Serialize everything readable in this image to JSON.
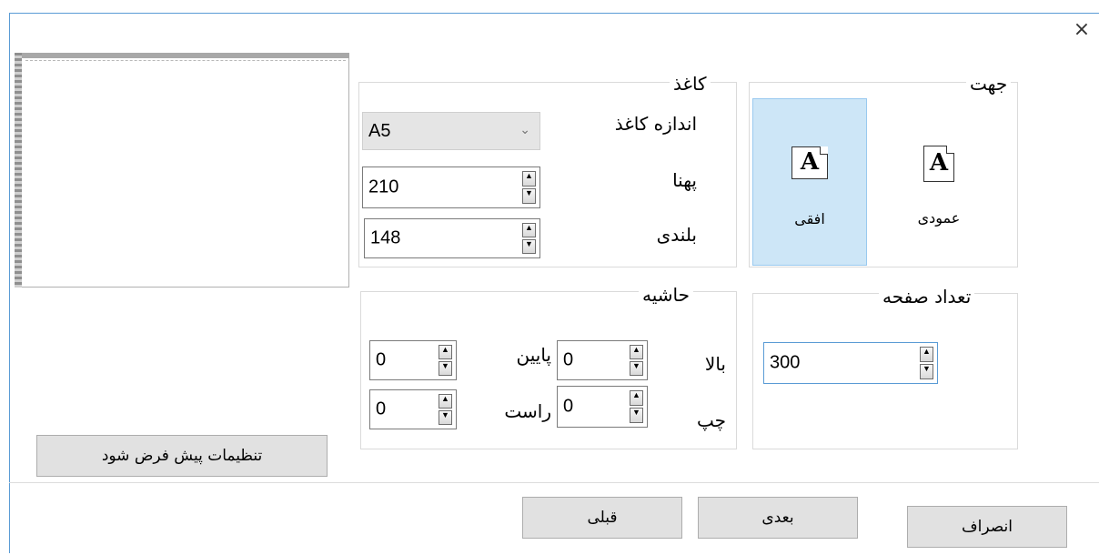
{
  "window": {
    "close_label": "×"
  },
  "orientation": {
    "legend": "جهت",
    "portrait_label": "عمودی",
    "landscape_label": "افقی",
    "icon_glyph": "A",
    "selected": "landscape"
  },
  "paper": {
    "legend": "کاغذ",
    "size_label": "اندازه کاغذ",
    "size_value": "A5",
    "width_label": "پهنا",
    "width_value": "210",
    "height_label": "بلندی",
    "height_value": "148"
  },
  "page_count": {
    "legend": "تعداد صفحه",
    "value": "300"
  },
  "margins": {
    "legend": "حاشیه",
    "top_label": "بالا",
    "top_value": "0",
    "bottom_label": "پایین",
    "bottom_value": "0",
    "left_label": "چپ",
    "left_value": "0",
    "right_label": "راست",
    "right_value": "0"
  },
  "buttons": {
    "defaults": "تنظیمات پیش فرض شود",
    "cancel": "انصراف",
    "next": "بعدی",
    "previous": "قبلی"
  },
  "colors": {
    "accent": "#5a9bd5",
    "selected_bg": "#cde6f7"
  }
}
